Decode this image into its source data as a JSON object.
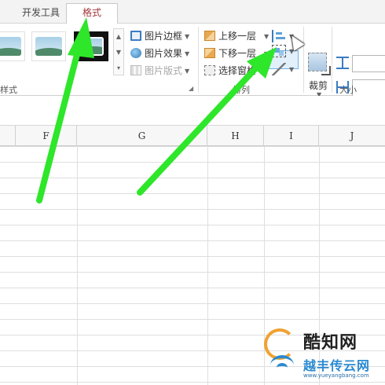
{
  "tabs": {
    "dev_tools": "开发工具",
    "format": "格式"
  },
  "ribbon": {
    "style_group_label": "样式",
    "picture_border": "图片边框",
    "picture_effects": "图片效果",
    "picture_layout": "图片版式",
    "bring_forward": "上移一层",
    "send_backward": "下移一层",
    "selection_pane": "选择窗格",
    "arrange_group_label": "排列",
    "crop": "裁剪",
    "size_group_label": "大小"
  },
  "columns": [
    "F",
    "G",
    "H",
    "I",
    "J"
  ],
  "watermark": {
    "title": "酷知网",
    "subtitle": "越丰传云网",
    "url": "www.yueyangbang.com"
  },
  "colors": {
    "format_tab_text": "#a4373a",
    "arrow_green": "#2ee62a",
    "highlight": "#6fb1e6"
  }
}
